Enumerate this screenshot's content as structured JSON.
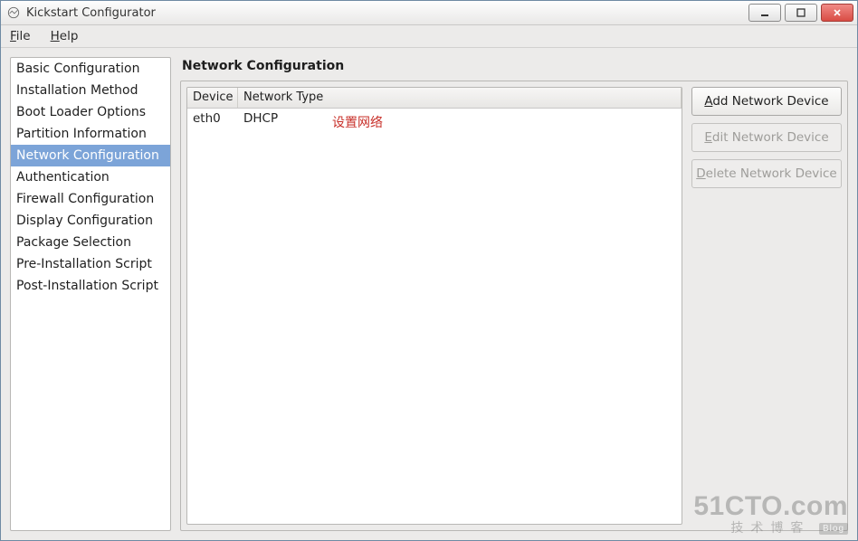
{
  "window": {
    "title": "Kickstart Configurator"
  },
  "menubar": {
    "file": {
      "prefix": "F",
      "rest": "ile"
    },
    "help": {
      "prefix": "H",
      "rest": "elp"
    }
  },
  "sidebar": {
    "items": [
      {
        "label": "Basic Configuration"
      },
      {
        "label": "Installation Method"
      },
      {
        "label": "Boot Loader Options"
      },
      {
        "label": "Partition Information"
      },
      {
        "label": "Network Configuration"
      },
      {
        "label": "Authentication"
      },
      {
        "label": "Firewall Configuration"
      },
      {
        "label": "Display Configuration"
      },
      {
        "label": "Package Selection"
      },
      {
        "label": "Pre-Installation Script"
      },
      {
        "label": "Post-Installation Script"
      }
    ],
    "selected_index": 4
  },
  "panel": {
    "title": "Network Configuration",
    "table": {
      "headers": {
        "device": "Device",
        "type": "Network Type"
      },
      "rows": [
        {
          "device": "eth0",
          "type": "DHCP"
        }
      ]
    },
    "annotation": "设置网络",
    "buttons": {
      "add": {
        "prefix": "A",
        "rest": "dd Network Device"
      },
      "edit": {
        "prefix": "E",
        "rest": "dit Network Device"
      },
      "delete": {
        "prefix": "D",
        "rest": "elete Network Device"
      }
    }
  },
  "watermark": {
    "main": "51CTO.com",
    "sub": "技术博客",
    "blog": "Blog"
  }
}
